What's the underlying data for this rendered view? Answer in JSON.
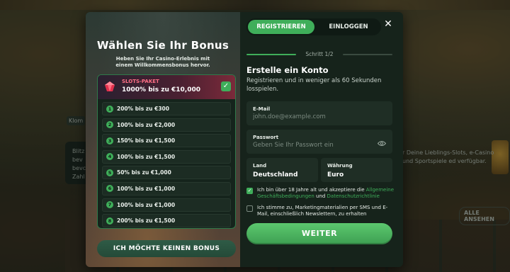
{
  "background": {
    "tag": "Klom",
    "left_text": "Blitz bev bevc Zahl",
    "right_text": "r Deine Lieblings-Slots, e-Casino und Sportspiele ed verfügbar.",
    "show_all": "ALLE ANSEHEN"
  },
  "bonus": {
    "title": "Wählen Sie Ihr Bonus",
    "subtitle": "Heben Sie Ihr Casino-Erlebnis mit einem Willkommensbonus hervor.",
    "package": {
      "label": "SLOTS-PAKET",
      "value": "1000% bis zu €10,000",
      "icon": "gem-icon",
      "selected": true
    },
    "offers": [
      {
        "num": "1",
        "text": "200% bis zu €300"
      },
      {
        "num": "2",
        "text": "100% bis zu €2,000"
      },
      {
        "num": "3",
        "text": "150% bis zu €1,500"
      },
      {
        "num": "4",
        "text": "100% bis zu €1,500"
      },
      {
        "num": "5",
        "text": "50% bis zu €1,000"
      },
      {
        "num": "6",
        "text": "100% bis zu €1,000"
      },
      {
        "num": "7",
        "text": "100% bis zu €1,000"
      },
      {
        "num": "8",
        "text": "200% bis zu €1,500"
      }
    ],
    "no_bonus": "ICH MÖCHTE KEINEN BONUS"
  },
  "form": {
    "tabs": {
      "register": "REGISTRIEREN",
      "login": "EINLOGGEN"
    },
    "step": "Schritt 1/2",
    "title": "Erstelle ein Konto",
    "subtitle": "Registrieren und in weniger als 60 Sekunden losspielen.",
    "email": {
      "label": "E-Mail",
      "placeholder": "john.doe@example.com",
      "value": ""
    },
    "password": {
      "label": "Passwort",
      "placeholder": "Geben Sie Ihr Passwort ein",
      "value": ""
    },
    "country": {
      "label": "Land",
      "value": "Deutschland"
    },
    "currency": {
      "label": "Währung",
      "value": "Euro"
    },
    "terms": {
      "checked": true,
      "text_before": "Ich bin über 18 Jahre alt und akzeptiere die ",
      "link1": "Allgemeine Geschäftsbedingungen",
      "text_mid": " und ",
      "link2": "Datenschutzrichtlinie"
    },
    "marketing": {
      "checked": false,
      "text": "Ich stimme zu, Marketingmaterialien per SMS und E-Mail, einschließlich Newslettern, zu erhalten"
    },
    "submit": "WEITER"
  },
  "colors": {
    "accent": "#3fae5a",
    "panel": "#16231b",
    "package_label": "#ff6f86"
  }
}
